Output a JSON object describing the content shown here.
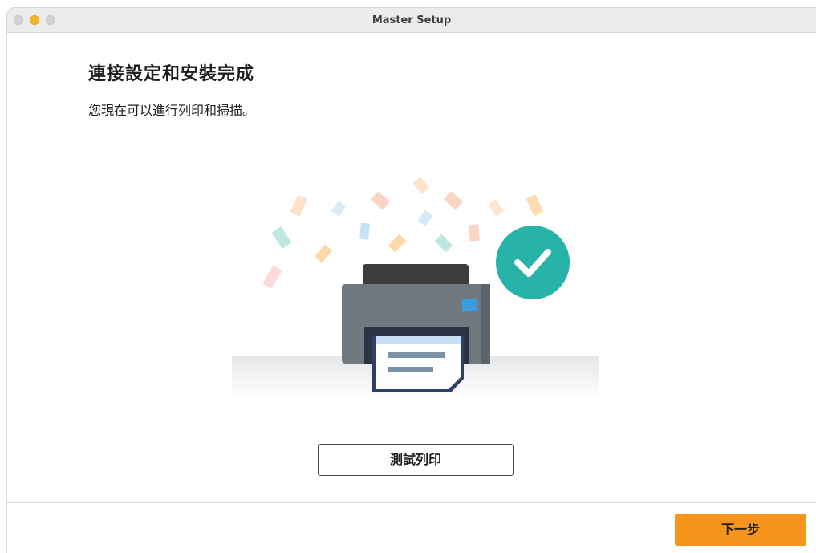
{
  "window": {
    "title": "Master Setup"
  },
  "main": {
    "heading": "連接設定和安裝完成",
    "subtext": "您現在可以進行列印和掃描。"
  },
  "buttons": {
    "test_print_label": "測試列印",
    "next_label": "下一步"
  },
  "colors": {
    "accent": "#f7941d",
    "success": "#27b3a8",
    "printer_body": "#707880",
    "printer_top": "#3d3d3d"
  },
  "icons": {
    "illustration": "printer-icon",
    "status": "checkmark-icon"
  }
}
